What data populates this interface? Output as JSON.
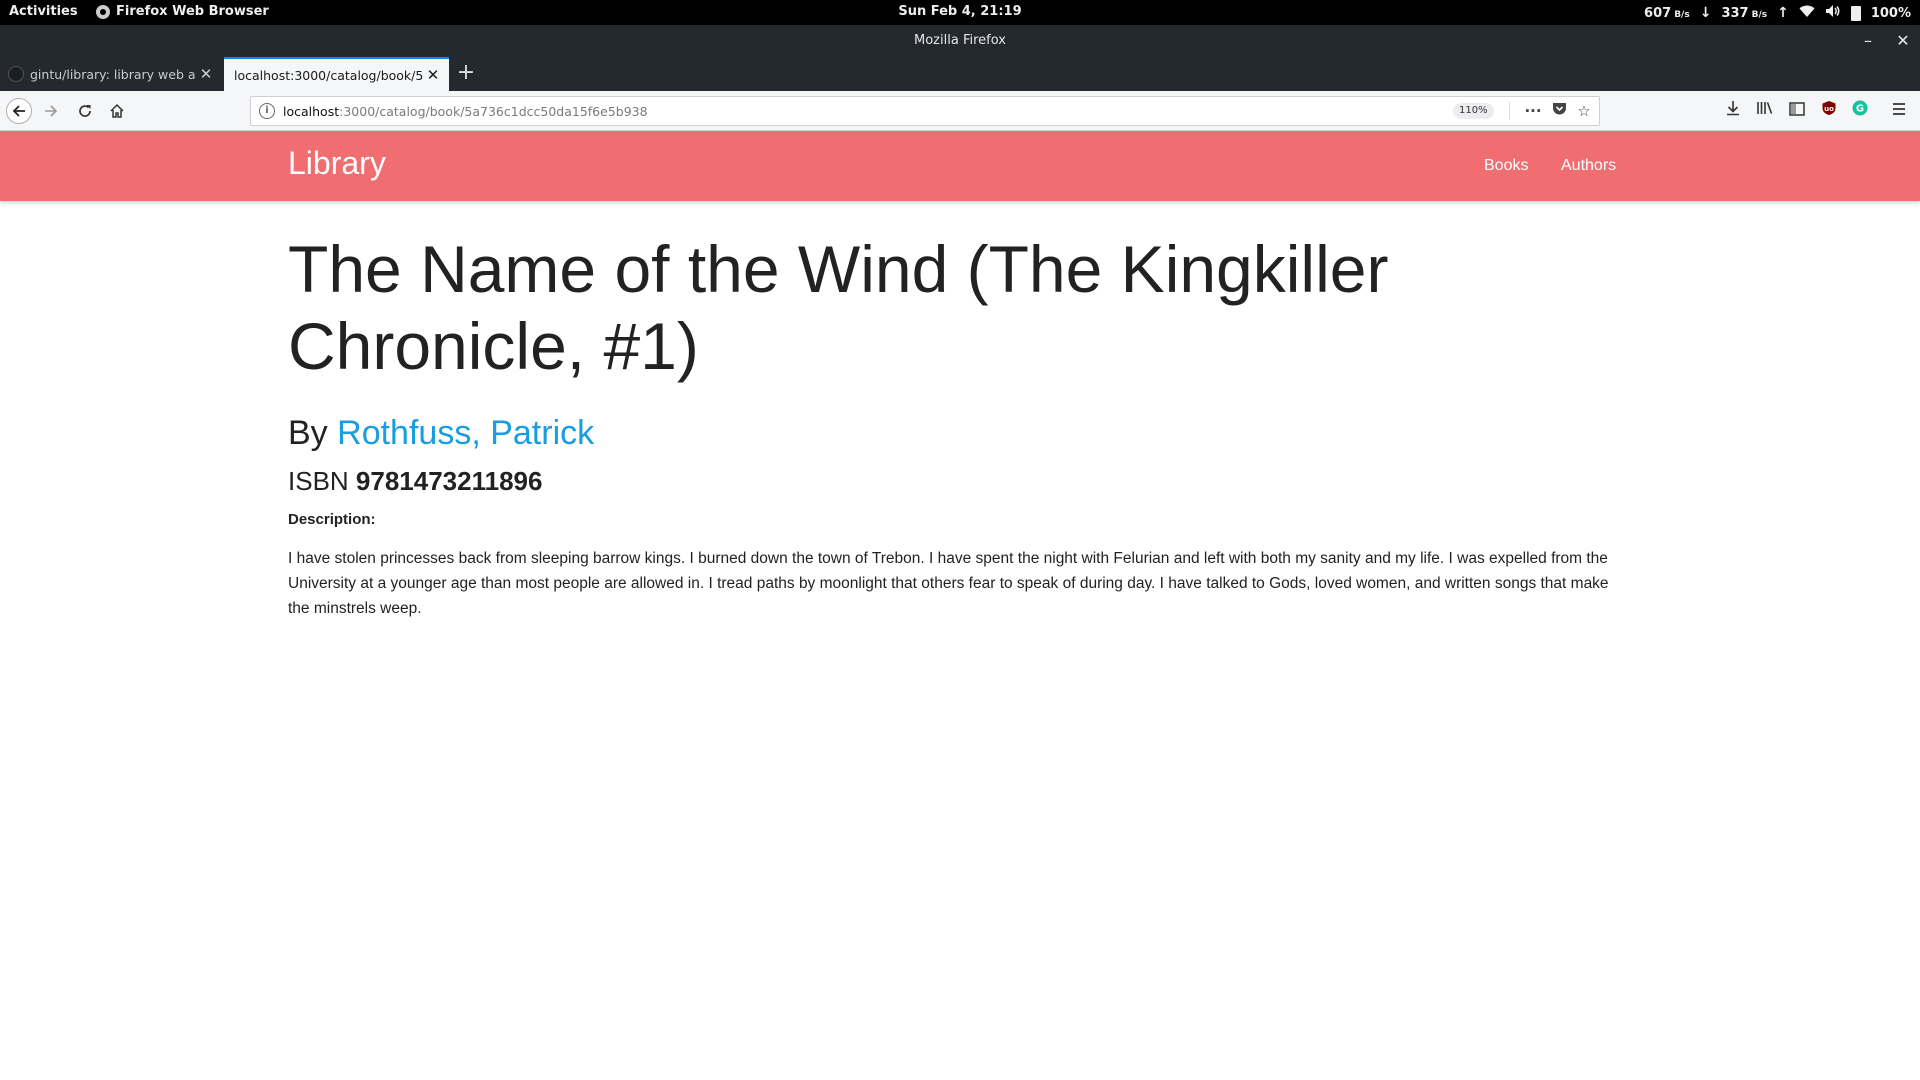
{
  "system_bar": {
    "activities": "Activities",
    "app_name": "Firefox Web Browser",
    "clock": "Sun Feb  4, 21:19",
    "net_down": "607",
    "net_down_unit": "B/s",
    "net_up": "337",
    "net_up_unit": "B/s",
    "battery": "100%"
  },
  "window": {
    "title": "Mozilla Firefox",
    "minimize": "–",
    "close": "✕"
  },
  "tabs": [
    {
      "label": "gintu/library: library web ap",
      "close": "✕",
      "icon": "github-icon"
    },
    {
      "label": "localhost:3000/catalog/book/5",
      "close": "✕"
    }
  ],
  "new_tab": "+",
  "address_bar": {
    "url_host": "localhost",
    "url_rest": ":3000/catalog/book/5a736c1dcc50da15f6e5b938",
    "zoom": "110%"
  },
  "site": {
    "brand": "Library",
    "nav": [
      {
        "label": "Books"
      },
      {
        "label": "Authors"
      }
    ]
  },
  "book": {
    "title": "The Name of the Wind (The Kingkiller Chronicle, #1)",
    "by_prefix": "By",
    "author": "Rothfuss, Patrick",
    "isbn_label": "ISBN",
    "isbn": "9781473211896",
    "description_label": "Description:",
    "description": "I have stolen princesses back from sleeping barrow kings. I burned down the town of Trebon. I have spent the night with Felurian and left with both my sanity and my life. I was expelled from the University at a younger age than most people are allowed in. I tread paths by moonlight that others fear to speak of during day. I have talked to Gods, loved women, and written songs that make the minstrels weep."
  },
  "colors": {
    "site_nav": "#f06e72",
    "author_link": "#1a9de0"
  }
}
